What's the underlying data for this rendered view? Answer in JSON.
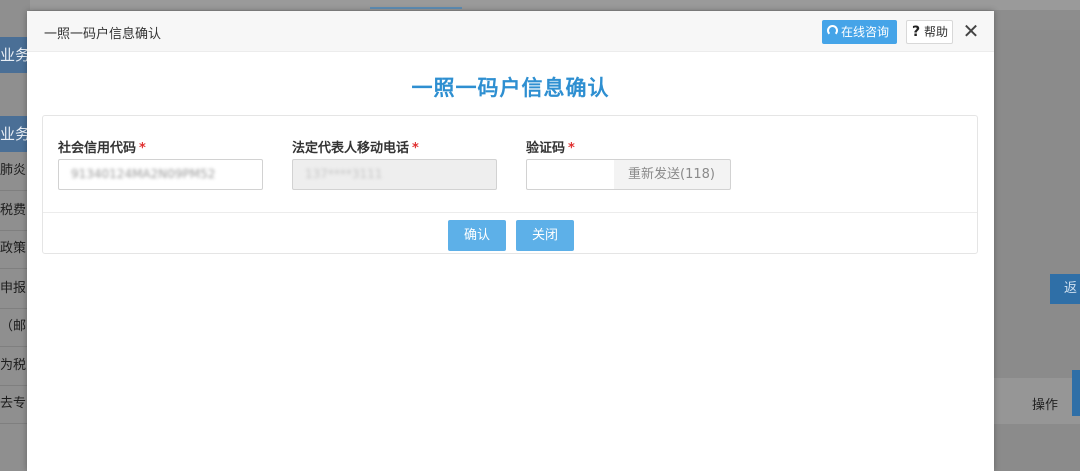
{
  "background": {
    "left_head_1": "业务",
    "left_head_2": "业务",
    "left_items": [
      "肺炎",
      "税费",
      "政策",
      "申报",
      "（邮",
      "为税",
      "去专"
    ],
    "return_label": "返",
    "op_label": "操作"
  },
  "modal": {
    "header_title": "一照一码户信息确认",
    "consult_label": "在线咨询",
    "help_label": "帮助",
    "help_icon": "?",
    "close_icon": "✕",
    "main_title": "一照一码户信息确认"
  },
  "form": {
    "credit_code": {
      "label": "社会信用代码",
      "value": "91340124MA2N09PM52"
    },
    "phone": {
      "label": "法定代表人移动电话",
      "value": "137****3111"
    },
    "captcha": {
      "label": "验证码",
      "value": "",
      "resend_label": "重新发送(118)"
    },
    "required_mark": "*",
    "confirm_label": "确认",
    "close_label": "关闭"
  },
  "colors": {
    "accent": "#2e8fd1",
    "button": "#5db0e8",
    "required": "#e03030"
  }
}
